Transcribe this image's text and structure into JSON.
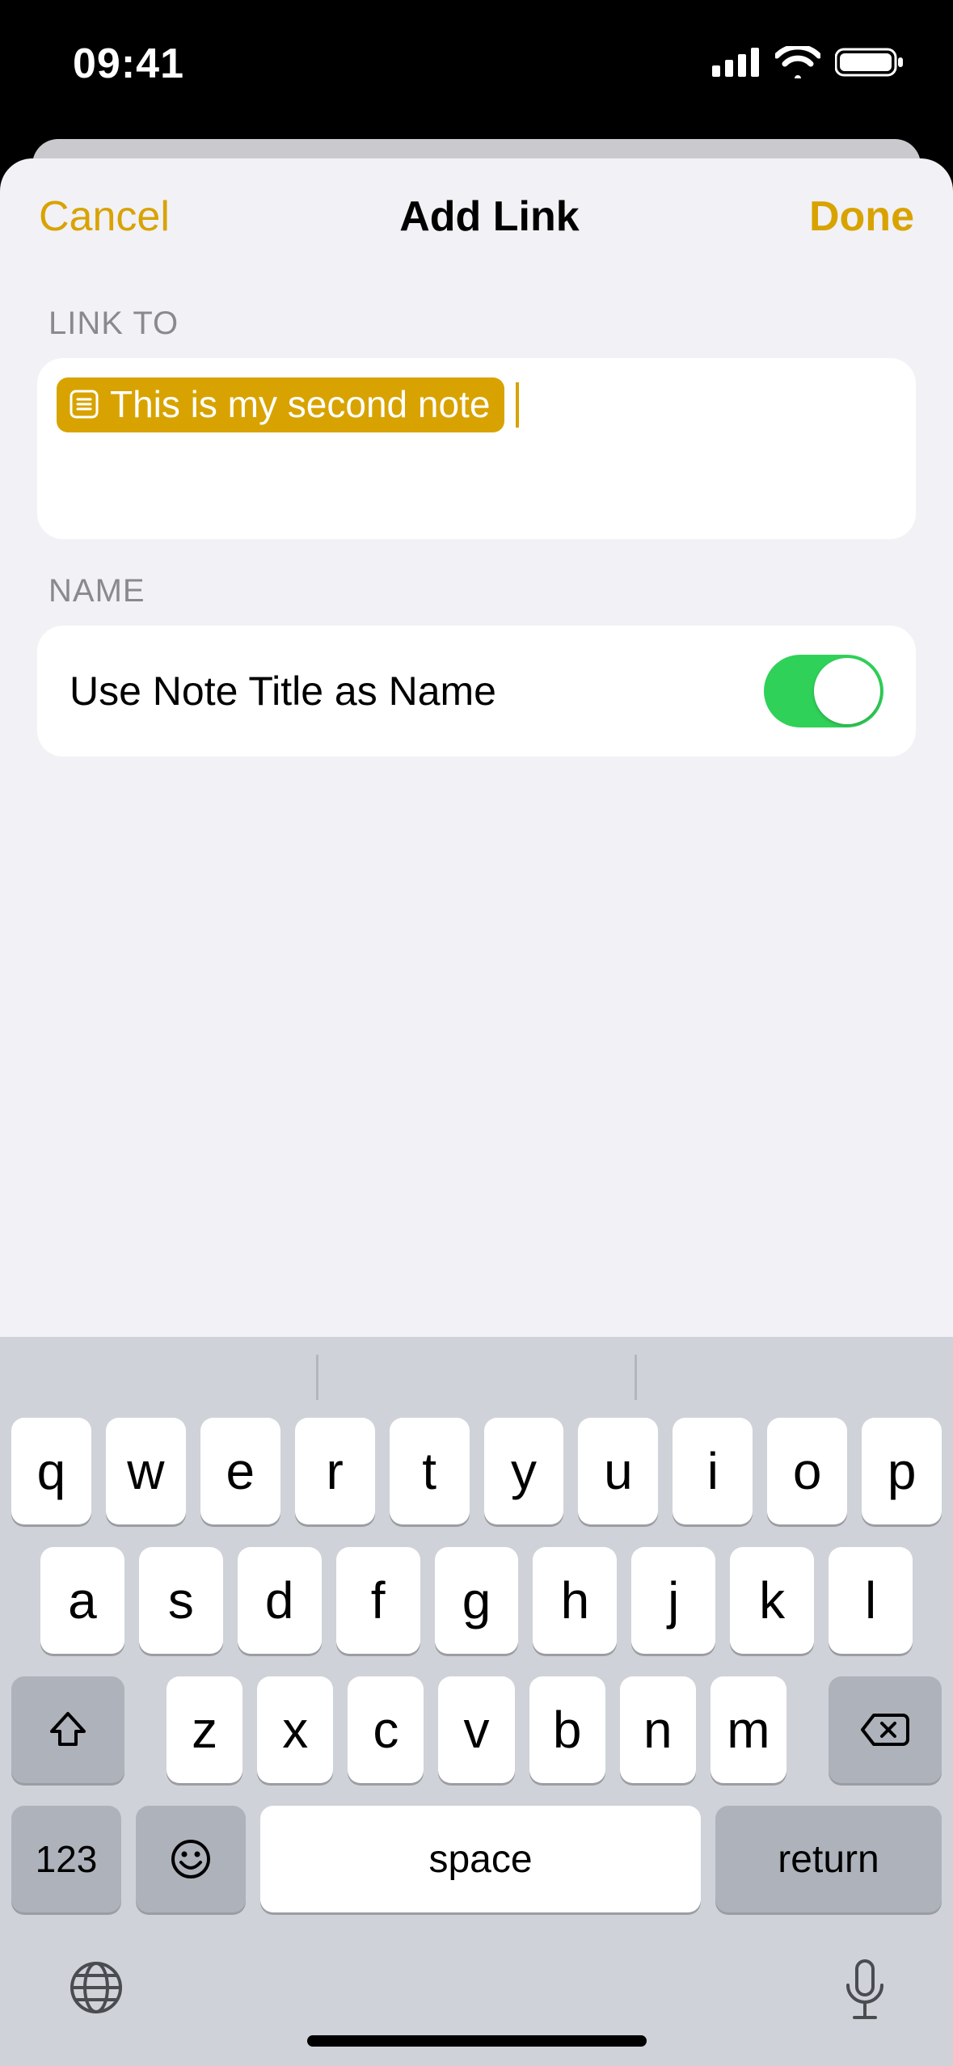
{
  "status": {
    "time": "09:41"
  },
  "header": {
    "cancel": "Cancel",
    "title": "Add Link",
    "done": "Done"
  },
  "sections": {
    "link_to": {
      "label": "LINK TO",
      "token": "This is my second note"
    },
    "name": {
      "label": "NAME",
      "row_label": "Use Note Title as Name",
      "toggle_on": true
    }
  },
  "keyboard": {
    "row1": [
      "q",
      "w",
      "e",
      "r",
      "t",
      "y",
      "u",
      "i",
      "o",
      "p"
    ],
    "row2": [
      "a",
      "s",
      "d",
      "f",
      "g",
      "h",
      "j",
      "k",
      "l"
    ],
    "row3": [
      "z",
      "x",
      "c",
      "v",
      "b",
      "n",
      "m"
    ],
    "numbers_label": "123",
    "space_label": "space",
    "return_label": "return"
  }
}
